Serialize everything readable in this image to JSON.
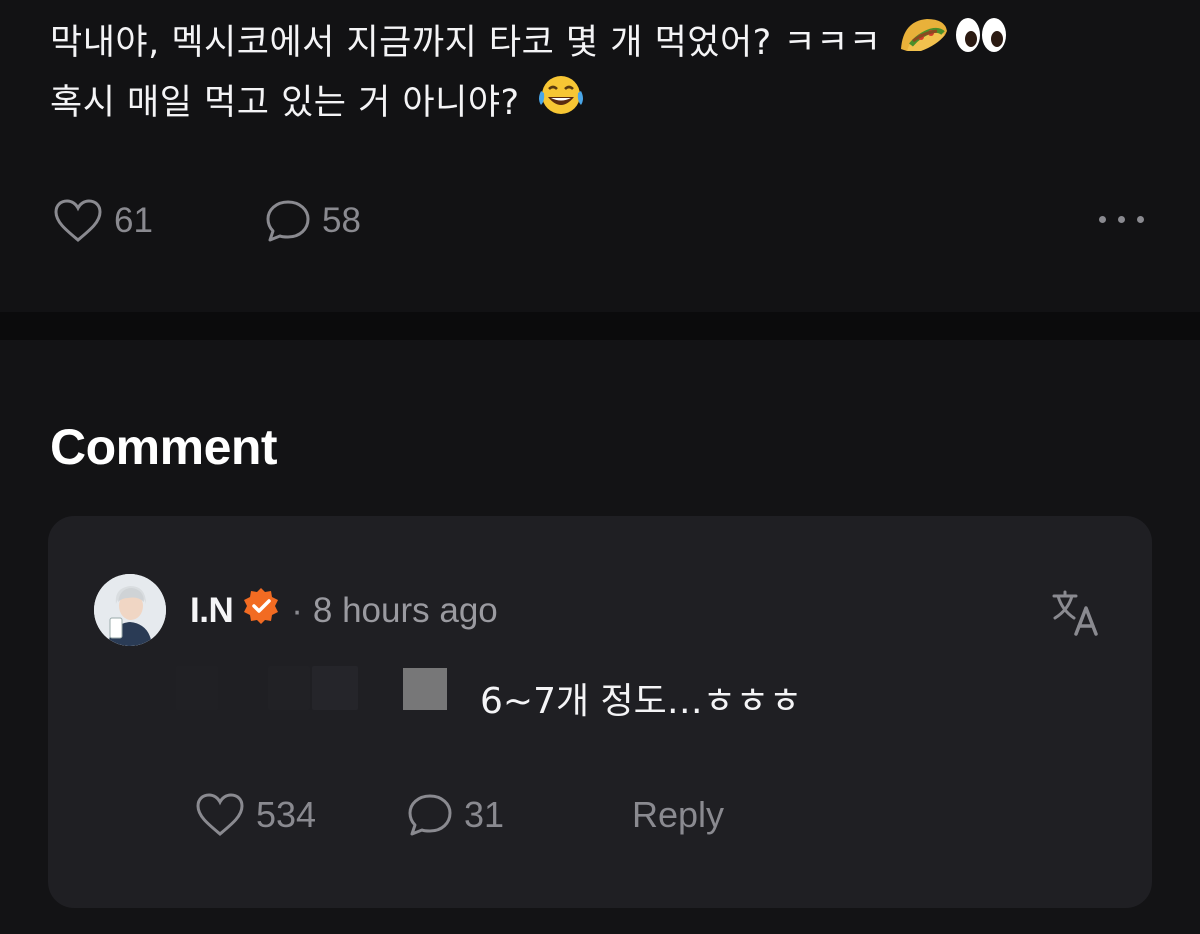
{
  "post": {
    "text_line1": "막내야, 멕시코에서 지금까지 타코 몇 개 먹었어? ㅋㅋㅋ",
    "text_line2": "혹시 매일 먹고 있는 거 아니야?",
    "emojis_line1": [
      "taco-icon",
      "eyes-icon"
    ],
    "emojis_line2": [
      "laughing-tears-icon"
    ],
    "like_count": "61",
    "comment_count": "58",
    "more_icon": "more-horizontal-icon"
  },
  "comments": {
    "section_title": "Comment",
    "items": [
      {
        "author": "I.N",
        "verified": true,
        "separator": "·",
        "time": "8 hours ago",
        "text": "6~7개 정도…ㅎㅎㅎ",
        "like_count": "534",
        "reply_count": "31",
        "reply_label": "Reply",
        "translate_icon": "translate-icon"
      }
    ]
  },
  "colors": {
    "background": "#111113",
    "card": "#1f1f23",
    "muted": "#8a8a90",
    "verified_badge": "#f26b22"
  }
}
